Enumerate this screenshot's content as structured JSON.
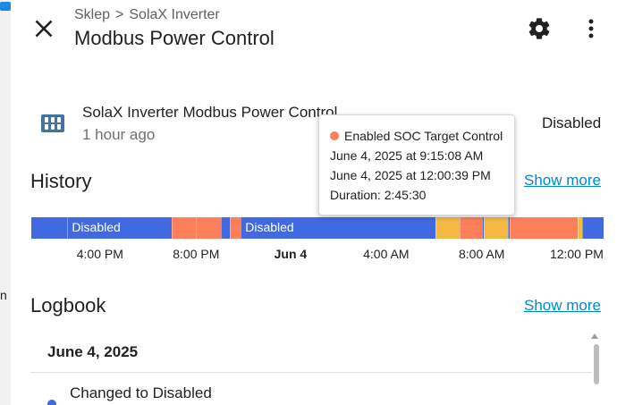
{
  "header": {
    "breadcrumb": [
      "Sklep",
      "SolaX Inverter"
    ],
    "breadcrumb_separator": ">",
    "title": "Modbus Power Control",
    "close_icon": "close-icon",
    "settings_icon": "gear-icon",
    "menu_icon": "more-vertical-icon"
  },
  "entity": {
    "icon": "inverter-icon",
    "name": "SolaX Inverter Modbus Power Control",
    "last_changed": "1 hour ago",
    "state": "Disabled"
  },
  "history": {
    "title": "History",
    "show_more": "Show more",
    "state_colors": {
      "Disabled": "#4169e1",
      "Enabled SOC Target Control": "#ff7f5a",
      "Other": "#f4b942"
    },
    "segments": [
      {
        "state": "Disabled",
        "label": "",
        "start": 0.0,
        "end": 0.063
      },
      {
        "state": "Disabled",
        "label": "Disabled",
        "start": 0.063,
        "end": 0.246
      },
      {
        "state": "Enabled SOC Target Control",
        "label": "",
        "start": 0.246,
        "end": 0.287
      },
      {
        "state": "Enabled SOC Target Control",
        "label": "",
        "start": 0.287,
        "end": 0.331
      },
      {
        "state": "Disabled",
        "label": "",
        "start": 0.331,
        "end": 0.347
      },
      {
        "state": "Enabled SOC Target Control",
        "label": "",
        "start": 0.347,
        "end": 0.366
      },
      {
        "state": "Disabled",
        "label": "Disabled",
        "start": 0.366,
        "end": 0.706
      },
      {
        "state": "Other",
        "label": "",
        "start": 0.706,
        "end": 0.748
      },
      {
        "state": "Enabled SOC Target Control",
        "label": "",
        "start": 0.748,
        "end": 0.787
      },
      {
        "state": "Disabled",
        "label": "",
        "start": 0.787,
        "end": 0.791
      },
      {
        "state": "Other",
        "label": "",
        "start": 0.791,
        "end": 0.833
      },
      {
        "state": "Disabled",
        "label": "",
        "start": 0.833,
        "end": 0.836
      },
      {
        "state": "Enabled SOC Target Control",
        "label": "",
        "start": 0.836,
        "end": 0.955
      },
      {
        "state": "Other",
        "label": "",
        "start": 0.955,
        "end": 0.963
      },
      {
        "state": "Disabled",
        "label": "",
        "start": 0.963,
        "end": 1.0
      }
    ],
    "axis_ticks": [
      {
        "label": "4:00 PM",
        "pos": 0.12,
        "bold": false
      },
      {
        "label": "8:00 PM",
        "pos": 0.288,
        "bold": false
      },
      {
        "label": "Jun 4",
        "pos": 0.453,
        "bold": true
      },
      {
        "label": "4:00 AM",
        "pos": 0.62,
        "bold": false
      },
      {
        "label": "8:00 AM",
        "pos": 0.787,
        "bold": false
      },
      {
        "label": "12:00 PM",
        "pos": 0.953,
        "bold": false
      }
    ],
    "tooltip": {
      "state": "Enabled SOC Target Control",
      "start": "June 4, 2025 at 9:15:08 AM",
      "end": "June 4, 2025 at 12:00:39 PM",
      "duration": "Duration: 2:45:30",
      "dot_color": "#ff7f5a"
    }
  },
  "logbook": {
    "title": "Logbook",
    "show_more": "Show more",
    "date": "June 4, 2025",
    "entries": [
      {
        "text": "Changed to Disabled",
        "dot_color": "#4169e1"
      }
    ]
  }
}
